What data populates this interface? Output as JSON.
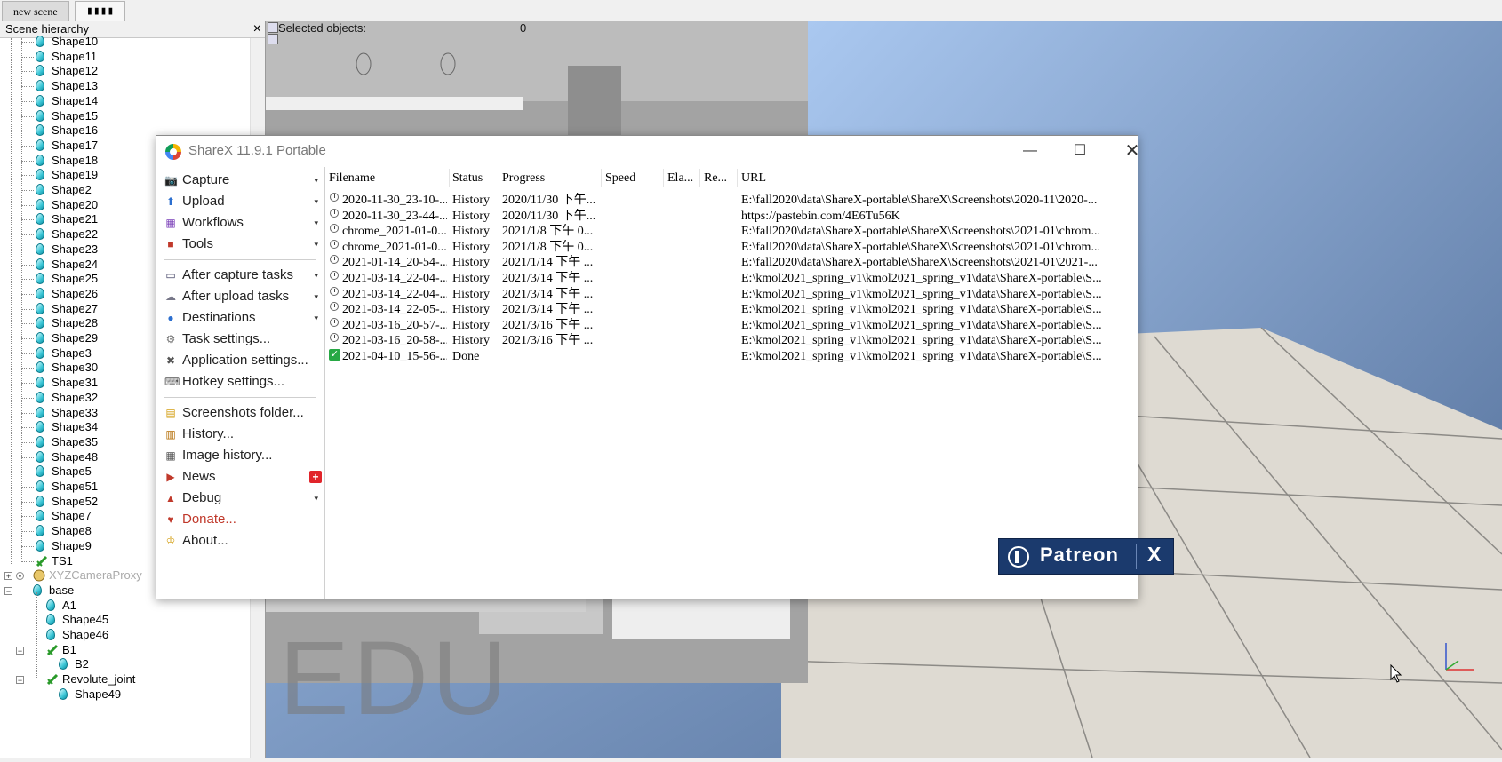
{
  "tabs": {
    "new_scene": "new scene",
    "current": "▮▮▮▮"
  },
  "hierarchy": {
    "title": "Scene hierarchy",
    "items": [
      "Shape10",
      "Shape11",
      "Shape12",
      "Shape13",
      "Shape14",
      "Shape15",
      "Shape16",
      "Shape17",
      "Shape18",
      "Shape19",
      "Shape2",
      "Shape20",
      "Shape21",
      "Shape22",
      "Shape23",
      "Shape24",
      "Shape25",
      "Shape26",
      "Shape27",
      "Shape28",
      "Shape29",
      "Shape3",
      "Shape30",
      "Shape31",
      "Shape32",
      "Shape33",
      "Shape34",
      "Shape35",
      "Shape48",
      "Shape5",
      "Shape51",
      "Shape52",
      "Shape7",
      "Shape8",
      "Shape9"
    ],
    "ts1": "TS1",
    "camera_proxy": "XYZCameraProxy",
    "base": "base",
    "a1": "A1",
    "shape45": "Shape45",
    "shape46": "Shape46",
    "b1": "B1",
    "b2": "B2",
    "revolute": "Revolute_joint",
    "shape49": "Shape49"
  },
  "viewport": {
    "selected_label": "Selected objects:",
    "selected_count": "0",
    "watermark": "EDU"
  },
  "sharex": {
    "title": "ShareX 11.9.1 Portable",
    "menu": {
      "capture": "Capture",
      "upload": "Upload",
      "workflows": "Workflows",
      "tools": "Tools",
      "after_capture": "After capture tasks",
      "after_upload": "After upload tasks",
      "destinations": "Destinations",
      "task_settings": "Task settings...",
      "app_settings": "Application settings...",
      "hotkey_settings": "Hotkey settings...",
      "screenshots_folder": "Screenshots folder...",
      "history": "History...",
      "image_history": "Image history...",
      "news": "News",
      "debug": "Debug",
      "donate": "Donate...",
      "about": "About..."
    },
    "columns": {
      "filename": "Filename",
      "status": "Status",
      "progress": "Progress",
      "speed": "Speed",
      "elapsed": "Ela...",
      "remaining": "Re...",
      "url": "URL"
    },
    "rows": [
      {
        "filename": "2020-11-30_23-10-...",
        "status": "History",
        "progress": "2020/11/30 下午...",
        "url": "E:\\fall2020\\data\\ShareX-portable\\ShareX\\Screenshots\\2020-11\\2020-..."
      },
      {
        "filename": "2020-11-30_23-44-...",
        "status": "History",
        "progress": "2020/11/30 下午...",
        "url": "https://pastebin.com/4E6Tu56K"
      },
      {
        "filename": "chrome_2021-01-0...",
        "status": "History",
        "progress": "2021/1/8 下午 0...",
        "url": "E:\\fall2020\\data\\ShareX-portable\\ShareX\\Screenshots\\2021-01\\chrom..."
      },
      {
        "filename": "chrome_2021-01-0...",
        "status": "History",
        "progress": "2021/1/8 下午 0...",
        "url": "E:\\fall2020\\data\\ShareX-portable\\ShareX\\Screenshots\\2021-01\\chrom..."
      },
      {
        "filename": "2021-01-14_20-54-...",
        "status": "History",
        "progress": "2021/1/14 下午 ...",
        "url": "E:\\fall2020\\data\\ShareX-portable\\ShareX\\Screenshots\\2021-01\\2021-..."
      },
      {
        "filename": "2021-03-14_22-04-...",
        "status": "History",
        "progress": "2021/3/14 下午 ...",
        "url": "E:\\kmol2021_spring_v1\\kmol2021_spring_v1\\data\\ShareX-portable\\S..."
      },
      {
        "filename": "2021-03-14_22-04-...",
        "status": "History",
        "progress": "2021/3/14 下午 ...",
        "url": "E:\\kmol2021_spring_v1\\kmol2021_spring_v1\\data\\ShareX-portable\\S..."
      },
      {
        "filename": "2021-03-14_22-05-...",
        "status": "History",
        "progress": "2021/3/14 下午 ...",
        "url": "E:\\kmol2021_spring_v1\\kmol2021_spring_v1\\data\\ShareX-portable\\S..."
      },
      {
        "filename": "2021-03-16_20-57-...",
        "status": "History",
        "progress": "2021/3/16 下午 ...",
        "url": "E:\\kmol2021_spring_v1\\kmol2021_spring_v1\\data\\ShareX-portable\\S..."
      },
      {
        "filename": "2021-03-16_20-58-...",
        "status": "History",
        "progress": "2021/3/16 下午 ...",
        "url": "E:\\kmol2021_spring_v1\\kmol2021_spring_v1\\data\\ShareX-portable\\S..."
      },
      {
        "filename": "2021-04-10_15-56-...",
        "status": "Done",
        "progress": "",
        "url": "E:\\kmol2021_spring_v1\\kmol2021_spring_v1\\data\\ShareX-portable\\S..."
      }
    ],
    "patreon_text": "Patreon",
    "patreon_x": "X"
  },
  "colors": {
    "donate": "#c0392b",
    "patreon_bg": "#1b3a6d",
    "floor": "#d8d4cc",
    "sky": "#a8c4e8"
  }
}
